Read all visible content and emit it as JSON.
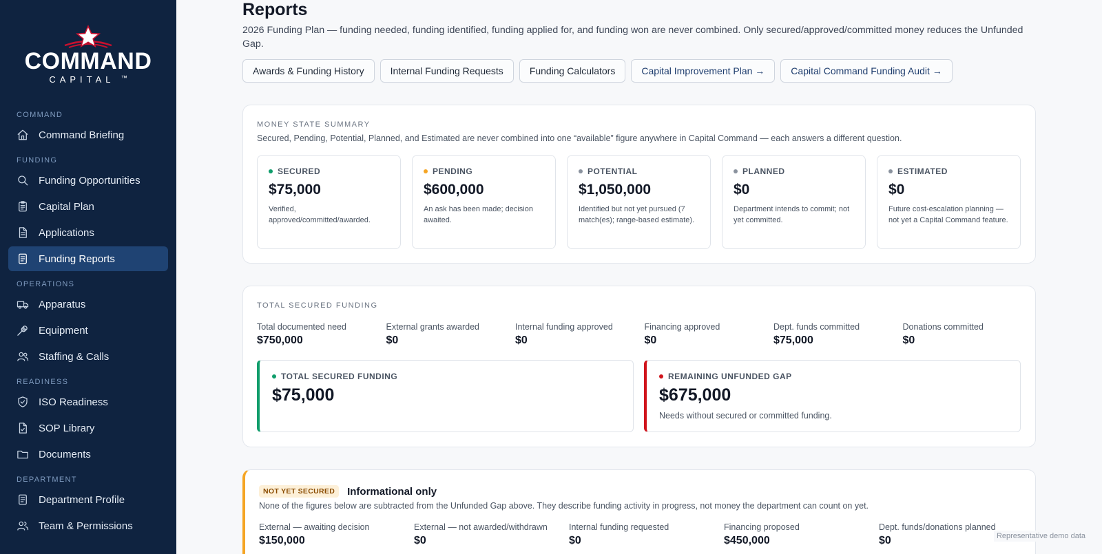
{
  "brand": {
    "name": "COMMAND",
    "sub": "CAPITAL",
    "tm": "™"
  },
  "sidebar": {
    "sections": [
      {
        "label": "COMMAND",
        "items": [
          {
            "label": "Command Briefing",
            "icon": "home-icon"
          }
        ]
      },
      {
        "label": "FUNDING",
        "items": [
          {
            "label": "Funding Opportunities",
            "icon": "search-icon"
          },
          {
            "label": "Capital Plan",
            "icon": "clipboard-icon"
          },
          {
            "label": "Applications",
            "icon": "file-icon"
          },
          {
            "label": "Funding Reports",
            "icon": "report-icon",
            "active": true
          }
        ]
      },
      {
        "label": "OPERATIONS",
        "items": [
          {
            "label": "Apparatus",
            "icon": "truck-icon"
          },
          {
            "label": "Equipment",
            "icon": "wrench-icon"
          },
          {
            "label": "Staffing & Calls",
            "icon": "users-icon"
          }
        ]
      },
      {
        "label": "READINESS",
        "items": [
          {
            "label": "ISO Readiness",
            "icon": "shield-check-icon"
          },
          {
            "label": "SOP Library",
            "icon": "document-check-icon"
          },
          {
            "label": "Documents",
            "icon": "folder-icon"
          }
        ]
      },
      {
        "label": "DEPARTMENT",
        "items": [
          {
            "label": "Department Profile",
            "icon": "report-icon"
          },
          {
            "label": "Team & Permissions",
            "icon": "team-icon"
          }
        ]
      }
    ]
  },
  "header": {
    "title": "Reports",
    "description": "2026 Funding Plan — funding needed, funding identified, funding applied for, and funding won are never combined. Only secured/approved/committed money reduces the Unfunded Gap."
  },
  "buttons": [
    {
      "label": "Awards & Funding History",
      "link": false
    },
    {
      "label": "Internal Funding Requests",
      "link": false
    },
    {
      "label": "Funding Calculators",
      "link": false
    },
    {
      "label": "Capital Improvement Plan →",
      "link": true
    },
    {
      "label": "Capital Command Funding Audit →",
      "link": true
    }
  ],
  "money_state": {
    "label": "MONEY STATE SUMMARY",
    "subtitle": "Secured, Pending, Potential, Planned, and Estimated are never combined into one “available” figure anywhere in Capital Command — each answers a different question.",
    "boxes": [
      {
        "label": "SECURED",
        "value": "$75,000",
        "desc": "Verified, approved/committed/awarded.",
        "color": "#0f9d6b"
      },
      {
        "label": "PENDING",
        "value": "$600,000",
        "desc": "An ask has been made; decision awaited.",
        "color": "#f5a524"
      },
      {
        "label": "POTENTIAL",
        "value": "$1,050,000",
        "desc": "Identified but not yet pursued (7 match(es); range-based estimate).",
        "color": "#8a929e"
      },
      {
        "label": "PLANNED",
        "value": "$0",
        "desc": "Department intends to commit; not yet committed.",
        "color": "#8a929e"
      },
      {
        "label": "ESTIMATED",
        "value": "$0",
        "desc": "Future cost-escalation planning — not yet a Capital Command feature.",
        "color": "#8a929e"
      }
    ]
  },
  "total_secured": {
    "label": "TOTAL SECURED FUNDING",
    "metrics": [
      {
        "label": "Total documented need",
        "value": "$750,000"
      },
      {
        "label": "External grants awarded",
        "value": "$0"
      },
      {
        "label": "Internal funding approved",
        "value": "$0"
      },
      {
        "label": "Financing approved",
        "value": "$0"
      },
      {
        "label": "Dept. funds committed",
        "value": "$75,000"
      },
      {
        "label": "Donations committed",
        "value": "$0"
      }
    ],
    "secured": {
      "label": "TOTAL SECURED FUNDING",
      "value": "$75,000",
      "color": "#0f9d6b"
    },
    "gap": {
      "label": "REMAINING UNFUNDED GAP",
      "value": "$675,000",
      "desc": "Needs without secured or committed funding.",
      "color": "#d0141c"
    }
  },
  "not_secured": {
    "badge": "NOT YET SECURED",
    "title": "Informational only",
    "subtitle": "None of the figures below are subtracted from the Unfunded Gap above. They describe funding activity in progress, not money the department can count on yet.",
    "metrics": [
      {
        "label": "External — awaiting decision",
        "value": "$150,000"
      },
      {
        "label": "External — not awarded/withdrawn",
        "value": "$0"
      },
      {
        "label": "Internal funding requested",
        "value": "$0"
      },
      {
        "label": "Financing proposed",
        "value": "$450,000"
      },
      {
        "label": "Dept. funds/donations planned",
        "value": "$0"
      }
    ]
  },
  "demo_note": "Representative demo data"
}
